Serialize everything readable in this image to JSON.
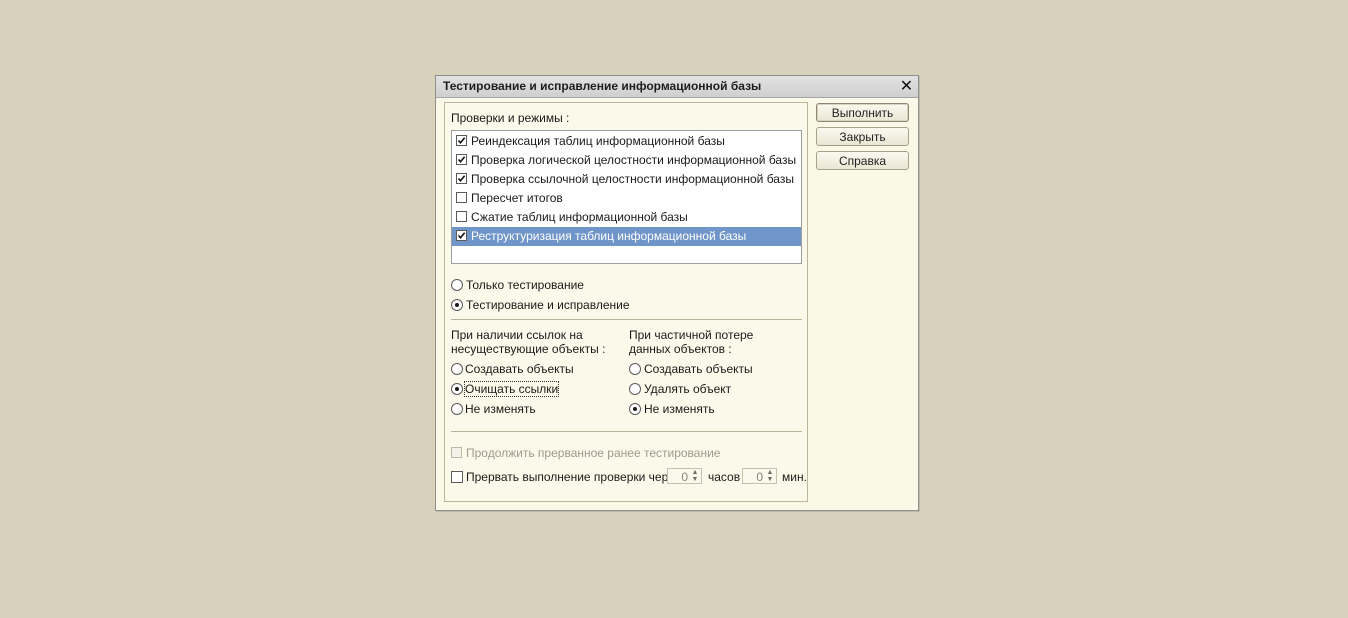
{
  "dialog": {
    "title": "Тестирование и исправление информационной базы",
    "close_glyph": "✕"
  },
  "checks": {
    "heading": "Проверки и режимы :",
    "items": [
      {
        "label": "Реиндексация таблиц информационной базы",
        "checked": true,
        "selected": false
      },
      {
        "label": "Проверка логической целостности информационной базы",
        "checked": true,
        "selected": false
      },
      {
        "label": "Проверка ссылочной целостности информационной базы",
        "checked": true,
        "selected": false
      },
      {
        "label": "Пересчет итогов",
        "checked": false,
        "selected": false
      },
      {
        "label": "Сжатие таблиц информационной базы",
        "checked": false,
        "selected": false
      },
      {
        "label": "Реструктуризация таблиц информационной базы",
        "checked": true,
        "selected": true
      }
    ]
  },
  "mode": {
    "options": [
      {
        "label": "Только тестирование",
        "selected": false
      },
      {
        "label": "Тестирование и исправление",
        "selected": true
      }
    ]
  },
  "missing_refs": {
    "heading_line1": "При наличии ссылок на",
    "heading_line2": "несуществующие объекты :",
    "options": [
      {
        "label": "Создавать объекты",
        "selected": false
      },
      {
        "label": "Очищать ссылки",
        "selected": true
      },
      {
        "label": "Не изменять",
        "selected": false
      }
    ]
  },
  "partial_loss": {
    "heading_line1": "При частичной потере",
    "heading_line2": "данных объектов :",
    "options": [
      {
        "label": "Создавать объекты",
        "selected": false
      },
      {
        "label": "Удалять объект",
        "selected": false
      },
      {
        "label": "Не изменять",
        "selected": true
      }
    ]
  },
  "continue_testing": {
    "label": "Продолжить прерванное ранее тестирование",
    "checked": false,
    "enabled": false
  },
  "interrupt": {
    "label": "Прервать выполнение проверки через",
    "checked": false,
    "hours_value": "0",
    "hours_unit": "часов",
    "minutes_value": "0",
    "minutes_unit": "мин.",
    "arrow_up": "▲",
    "arrow_down": "▼"
  },
  "buttons": {
    "run": "Выполнить",
    "close": "Закрыть",
    "help": "Справка"
  },
  "colors": {
    "background": "#d8d2bd",
    "dialog_bg": "#faf8e7",
    "selection": "#6f95c9"
  }
}
